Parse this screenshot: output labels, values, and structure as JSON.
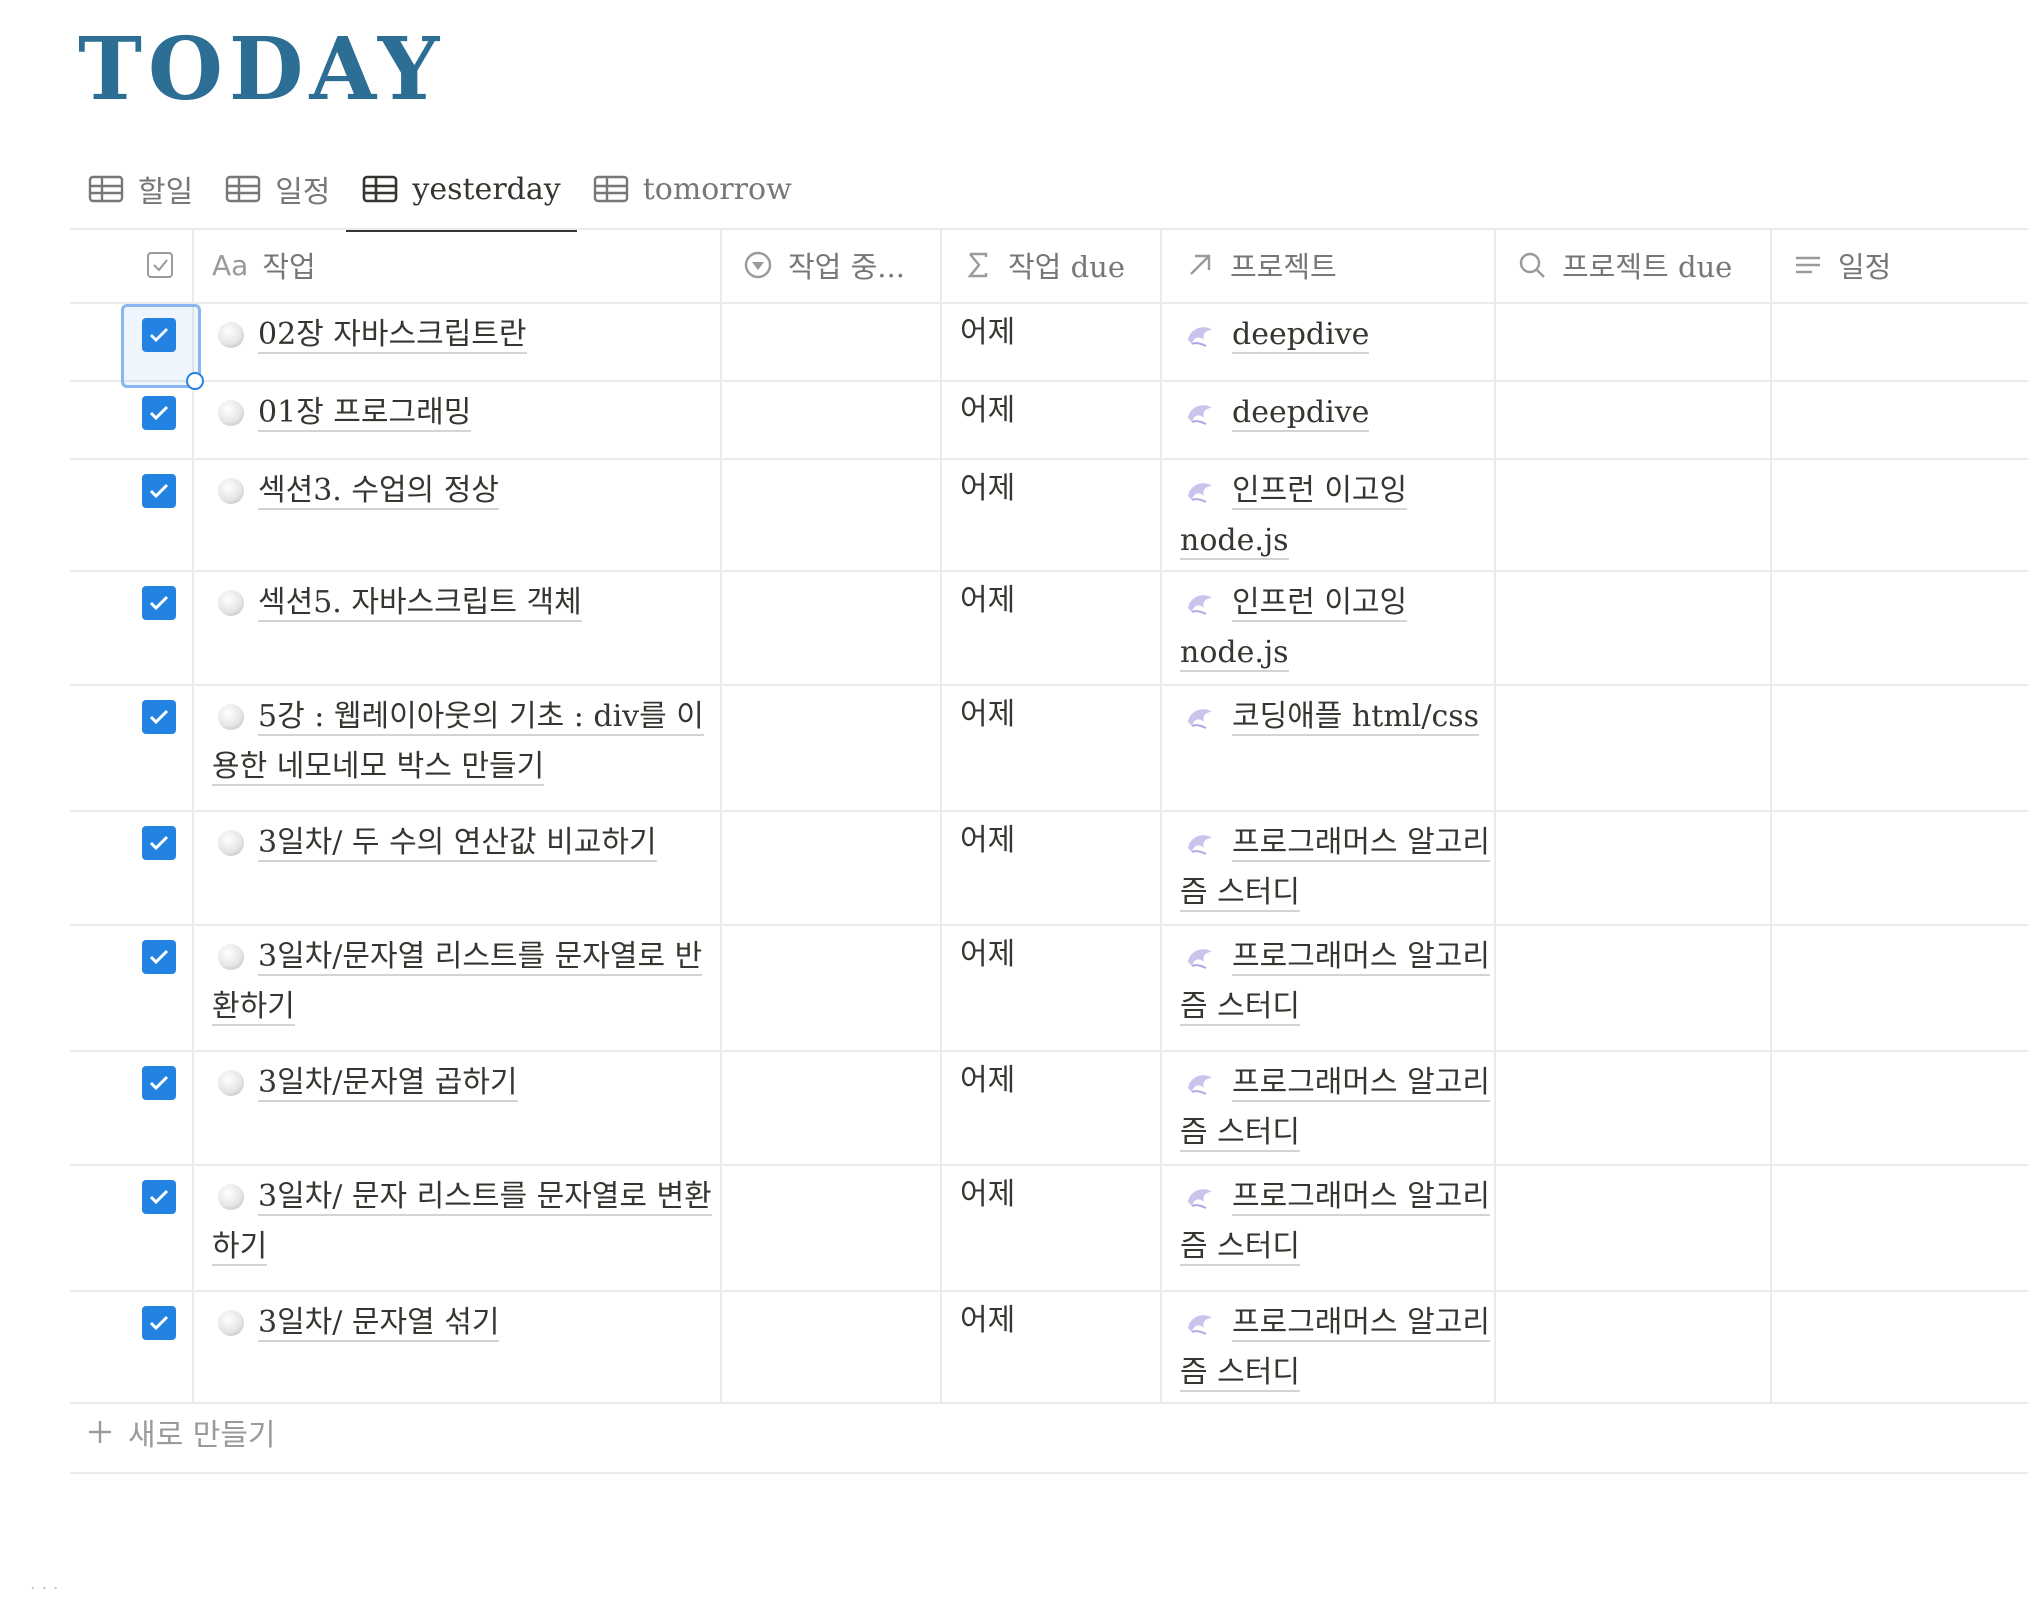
{
  "page": {
    "title": "TODAY"
  },
  "tabs": [
    {
      "label": "할일",
      "active": false
    },
    {
      "label": "일정",
      "active": false
    },
    {
      "label": "yesterday",
      "active": true
    },
    {
      "label": "tomorrow",
      "active": false
    }
  ],
  "columns": [
    {
      "label": "",
      "icon": "checkbox-icon"
    },
    {
      "label": "작업",
      "icon": "text-aa-icon"
    },
    {
      "label": "작업 중...",
      "icon": "status-icon"
    },
    {
      "label": "작업 due",
      "icon": "sigma-icon"
    },
    {
      "label": "프로젝트",
      "icon": "relation-arrow-icon"
    },
    {
      "label": "프로젝트 due",
      "icon": "search-icon"
    },
    {
      "label": "일정",
      "icon": "lines-icon"
    }
  ],
  "rows": [
    {
      "done": true,
      "task": "02장 자바스크립트란",
      "due": "어제",
      "project": "deepdive"
    },
    {
      "done": true,
      "task": "01장 프로그래밍",
      "due": "어제",
      "project": "deepdive"
    },
    {
      "done": true,
      "task": "섹션3. 수업의 정상",
      "due": "어제",
      "project": "인프런 이고잉 node.js"
    },
    {
      "done": true,
      "task": "섹션5. 자바스크립트 객체",
      "due": "어제",
      "project": "인프런 이고잉 node.js"
    },
    {
      "done": true,
      "task": "5강 : 웹레이아웃의 기초 : div를 이용한 네모네모 박스 만들기",
      "due": "어제",
      "project": "코딩애플 html/css"
    },
    {
      "done": true,
      "task": "3일차/ 두 수의 연산값 비교하기",
      "due": "어제",
      "project": "프로그래머스 알고리즘 스터디"
    },
    {
      "done": true,
      "task": "3일차/문자열 리스트를 문자열로 반환하기",
      "due": "어제",
      "project": "프로그래머스 알고리즘 스터디"
    },
    {
      "done": true,
      "task": "3일차/문자열 곱하기",
      "due": "어제",
      "project": "프로그래머스 알고리즘 스터디"
    },
    {
      "done": true,
      "task": "3일차/ 문자 리스트를 문자열로 변환하기",
      "due": "어제",
      "project": "프로그래머스 알고리즘 스터디"
    },
    {
      "done": true,
      "task": "3일차/ 문자열 섞기",
      "due": "어제",
      "project": "프로그래머스 알고리즘 스터디"
    }
  ],
  "new_row": {
    "label": "새로 만들기"
  },
  "colors": {
    "title": "#2d6e94",
    "checkbox": "#2383e2",
    "border": "#ebebea",
    "muted": "#787774"
  }
}
